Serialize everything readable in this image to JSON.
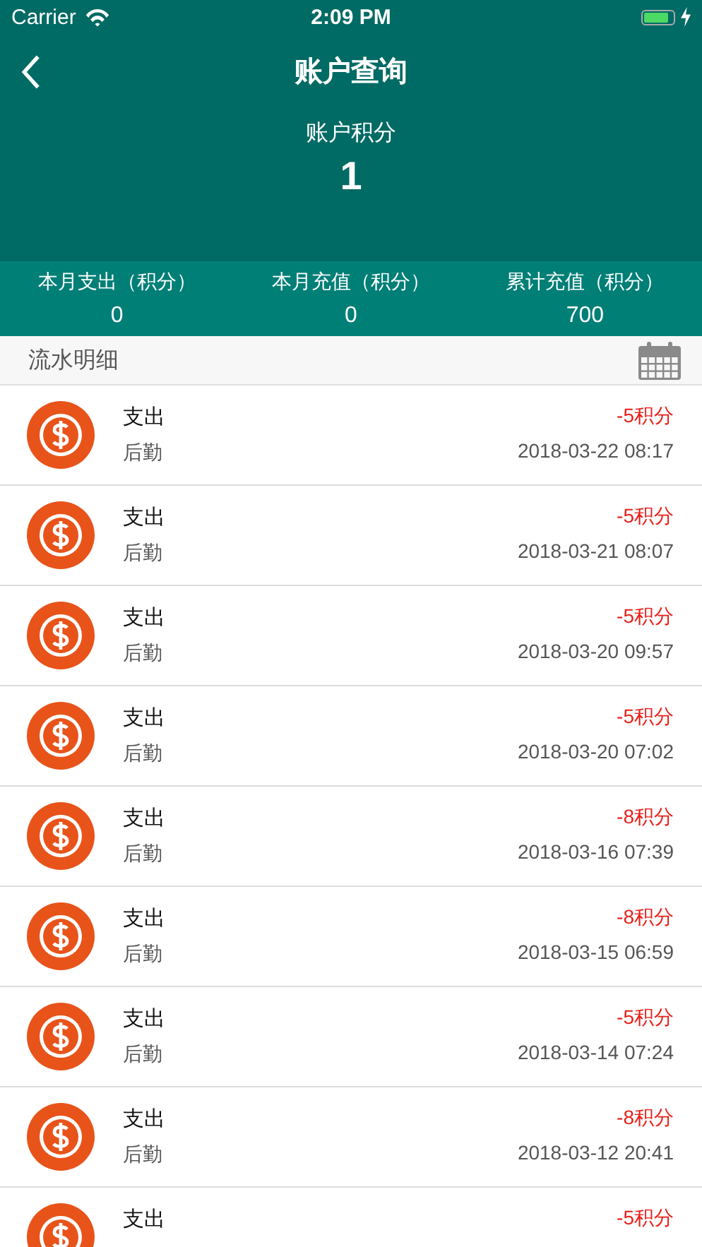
{
  "status_bar": {
    "carrier": "Carrier",
    "time": "2:09 PM"
  },
  "nav": {
    "title": "账户查询"
  },
  "balance": {
    "label": "账户积分",
    "value": "1"
  },
  "stats": [
    {
      "label": "本月支出（积分）",
      "value": "0"
    },
    {
      "label": "本月充值（积分）",
      "value": "0"
    },
    {
      "label": "累计充值（积分）",
      "value": "700"
    }
  ],
  "section": {
    "title": "流水明细"
  },
  "records": [
    {
      "title": "支出",
      "category": "后勤",
      "amount": "-5积分",
      "time": "2018-03-22 08:17"
    },
    {
      "title": "支出",
      "category": "后勤",
      "amount": "-5积分",
      "time": "2018-03-21 08:07"
    },
    {
      "title": "支出",
      "category": "后勤",
      "amount": "-5积分",
      "time": "2018-03-20 09:57"
    },
    {
      "title": "支出",
      "category": "后勤",
      "amount": "-5积分",
      "time": "2018-03-20 07:02"
    },
    {
      "title": "支出",
      "category": "后勤",
      "amount": "-8积分",
      "time": "2018-03-16 07:39"
    },
    {
      "title": "支出",
      "category": "后勤",
      "amount": "-8积分",
      "time": "2018-03-15 06:59"
    },
    {
      "title": "支出",
      "category": "后勤",
      "amount": "-5积分",
      "time": "2018-03-14 07:24"
    },
    {
      "title": "支出",
      "category": "后勤",
      "amount": "-8积分",
      "time": "2018-03-12 20:41"
    },
    {
      "title": "支出",
      "amount": "-5积分"
    }
  ]
}
